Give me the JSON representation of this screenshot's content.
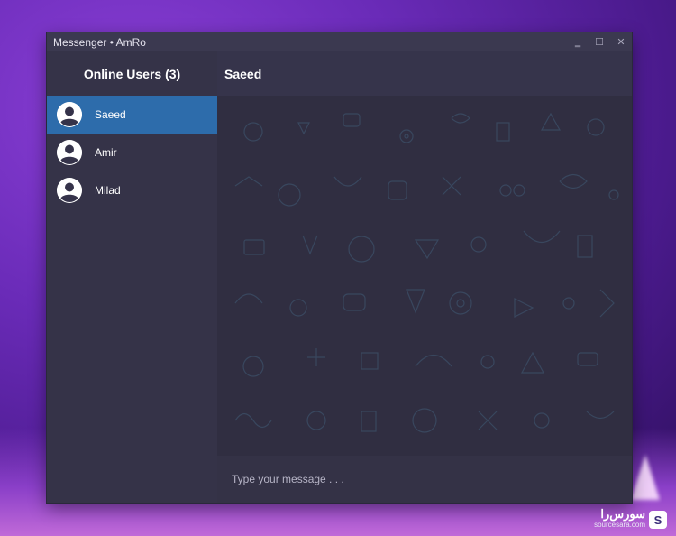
{
  "window": {
    "title": "Messenger • AmRo",
    "controls": {
      "minimize": "‗",
      "maximize": "☐",
      "close": "✕"
    }
  },
  "sidebar": {
    "header": "Online Users (3)",
    "users": [
      {
        "name": "Saeed",
        "active": true
      },
      {
        "name": "Amir",
        "active": false
      },
      {
        "name": "Milad",
        "active": false
      }
    ]
  },
  "chat": {
    "title": "Saeed",
    "input_placeholder": "Type your message . . ."
  },
  "watermark": {
    "text": "سورس‌را",
    "sub": "sourcesara.com"
  },
  "colors": {
    "active_user": "#2d6cab",
    "window_bg": "#35334a",
    "chat_bg": "#2f2d40"
  }
}
